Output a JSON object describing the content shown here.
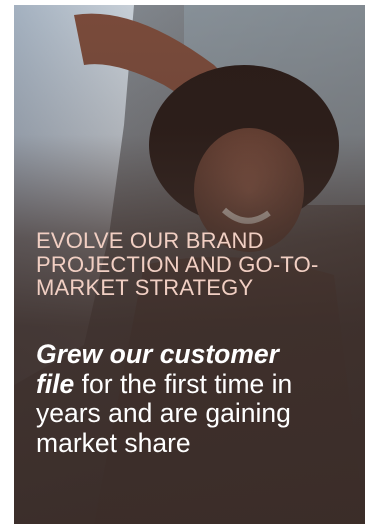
{
  "card": {
    "eyebrow": "EVOLVE OUR BRAND PROJECTION AND GO-TO-MARKET STRATEGY",
    "headline_emphasis_1": "Grew our customer",
    "headline_emphasis_2": "file",
    "headline_rest": " for the first time in years and are gaining market share"
  },
  "colors": {
    "eyebrow": "#f1cfc3",
    "headline": "#ffffff",
    "overlay": "#3e2f2a"
  }
}
